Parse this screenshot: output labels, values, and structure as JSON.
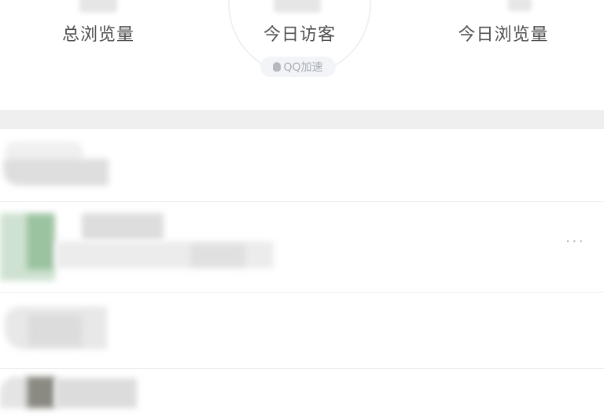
{
  "stats": {
    "total_views_label": "总浏览量",
    "today_visitors_label": "今日访客",
    "today_views_label": "今日浏览量",
    "speed_badge": "QQ加速"
  },
  "icons": {
    "speed_badge_icon": "qq-icon",
    "row_menu_icon": "more-icon"
  },
  "list": {
    "more_symbol": "···"
  },
  "colors": {
    "divider": "#efefef",
    "label": "#505050",
    "badge_text": "#a9aeb5",
    "blur_green": "#9bc39f"
  }
}
